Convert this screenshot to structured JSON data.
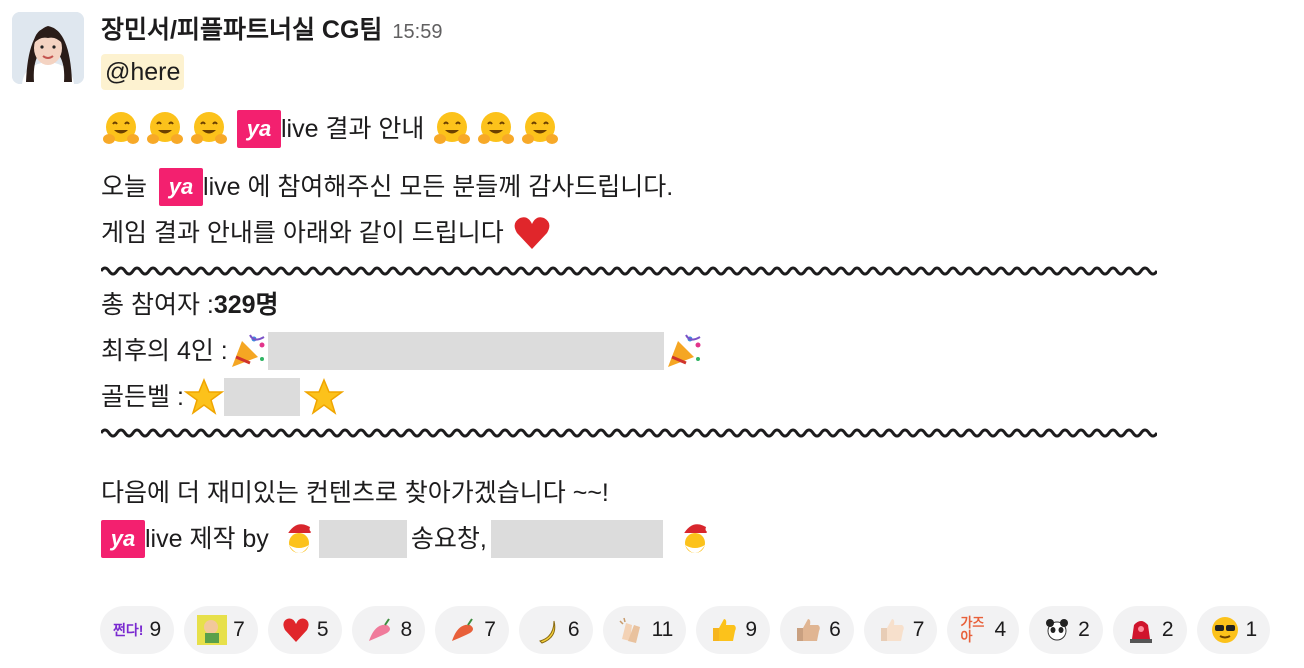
{
  "message": {
    "sender": "장민서/피플파트너실 CG팀",
    "time": "15:59",
    "mention": "@here",
    "ya_label": "ya",
    "title_text": "live 결과 안내",
    "line1_a": "오늘",
    "line1_b": "live 에 참여해주신 모든 분들께 감사드립니다.",
    "line2": "게임 결과 안내를 아래와 같이 드립니다",
    "total_label": "총 참여자 : ",
    "total_value": "329명",
    "final4_label": "최후의 4인 : ",
    "goldenbell_label": "골든벨 : ",
    "closing": "다음에 더 재미있는 컨텐츠로 찾아가겠습니다 ~~!",
    "credit_a": "live 제작 by",
    "credit_name": "송요창",
    "credit_comma": ","
  },
  "reactions": [
    {
      "icon": "jjeonda-text",
      "label": "쩐다!",
      "count": "9"
    },
    {
      "icon": "character-icon",
      "count": "7"
    },
    {
      "icon": "heart-icon",
      "count": "5"
    },
    {
      "icon": "pink-pepper-icon",
      "count": "8"
    },
    {
      "icon": "pepper-icon",
      "count": "7"
    },
    {
      "icon": "banana-icon",
      "count": "6"
    },
    {
      "icon": "clap-icon",
      "count": "11"
    },
    {
      "icon": "thumbs-up-icon",
      "count": "9"
    },
    {
      "icon": "thumbs-up-medium-icon",
      "count": "6"
    },
    {
      "icon": "thumbs-up-light-icon",
      "count": "7"
    },
    {
      "icon": "gazua-text",
      "label": "가즈아",
      "count": "4"
    },
    {
      "icon": "panda-icon",
      "count": "2"
    },
    {
      "icon": "siren-icon",
      "count": "2"
    },
    {
      "icon": "sunglasses-icon",
      "count": "1"
    }
  ]
}
